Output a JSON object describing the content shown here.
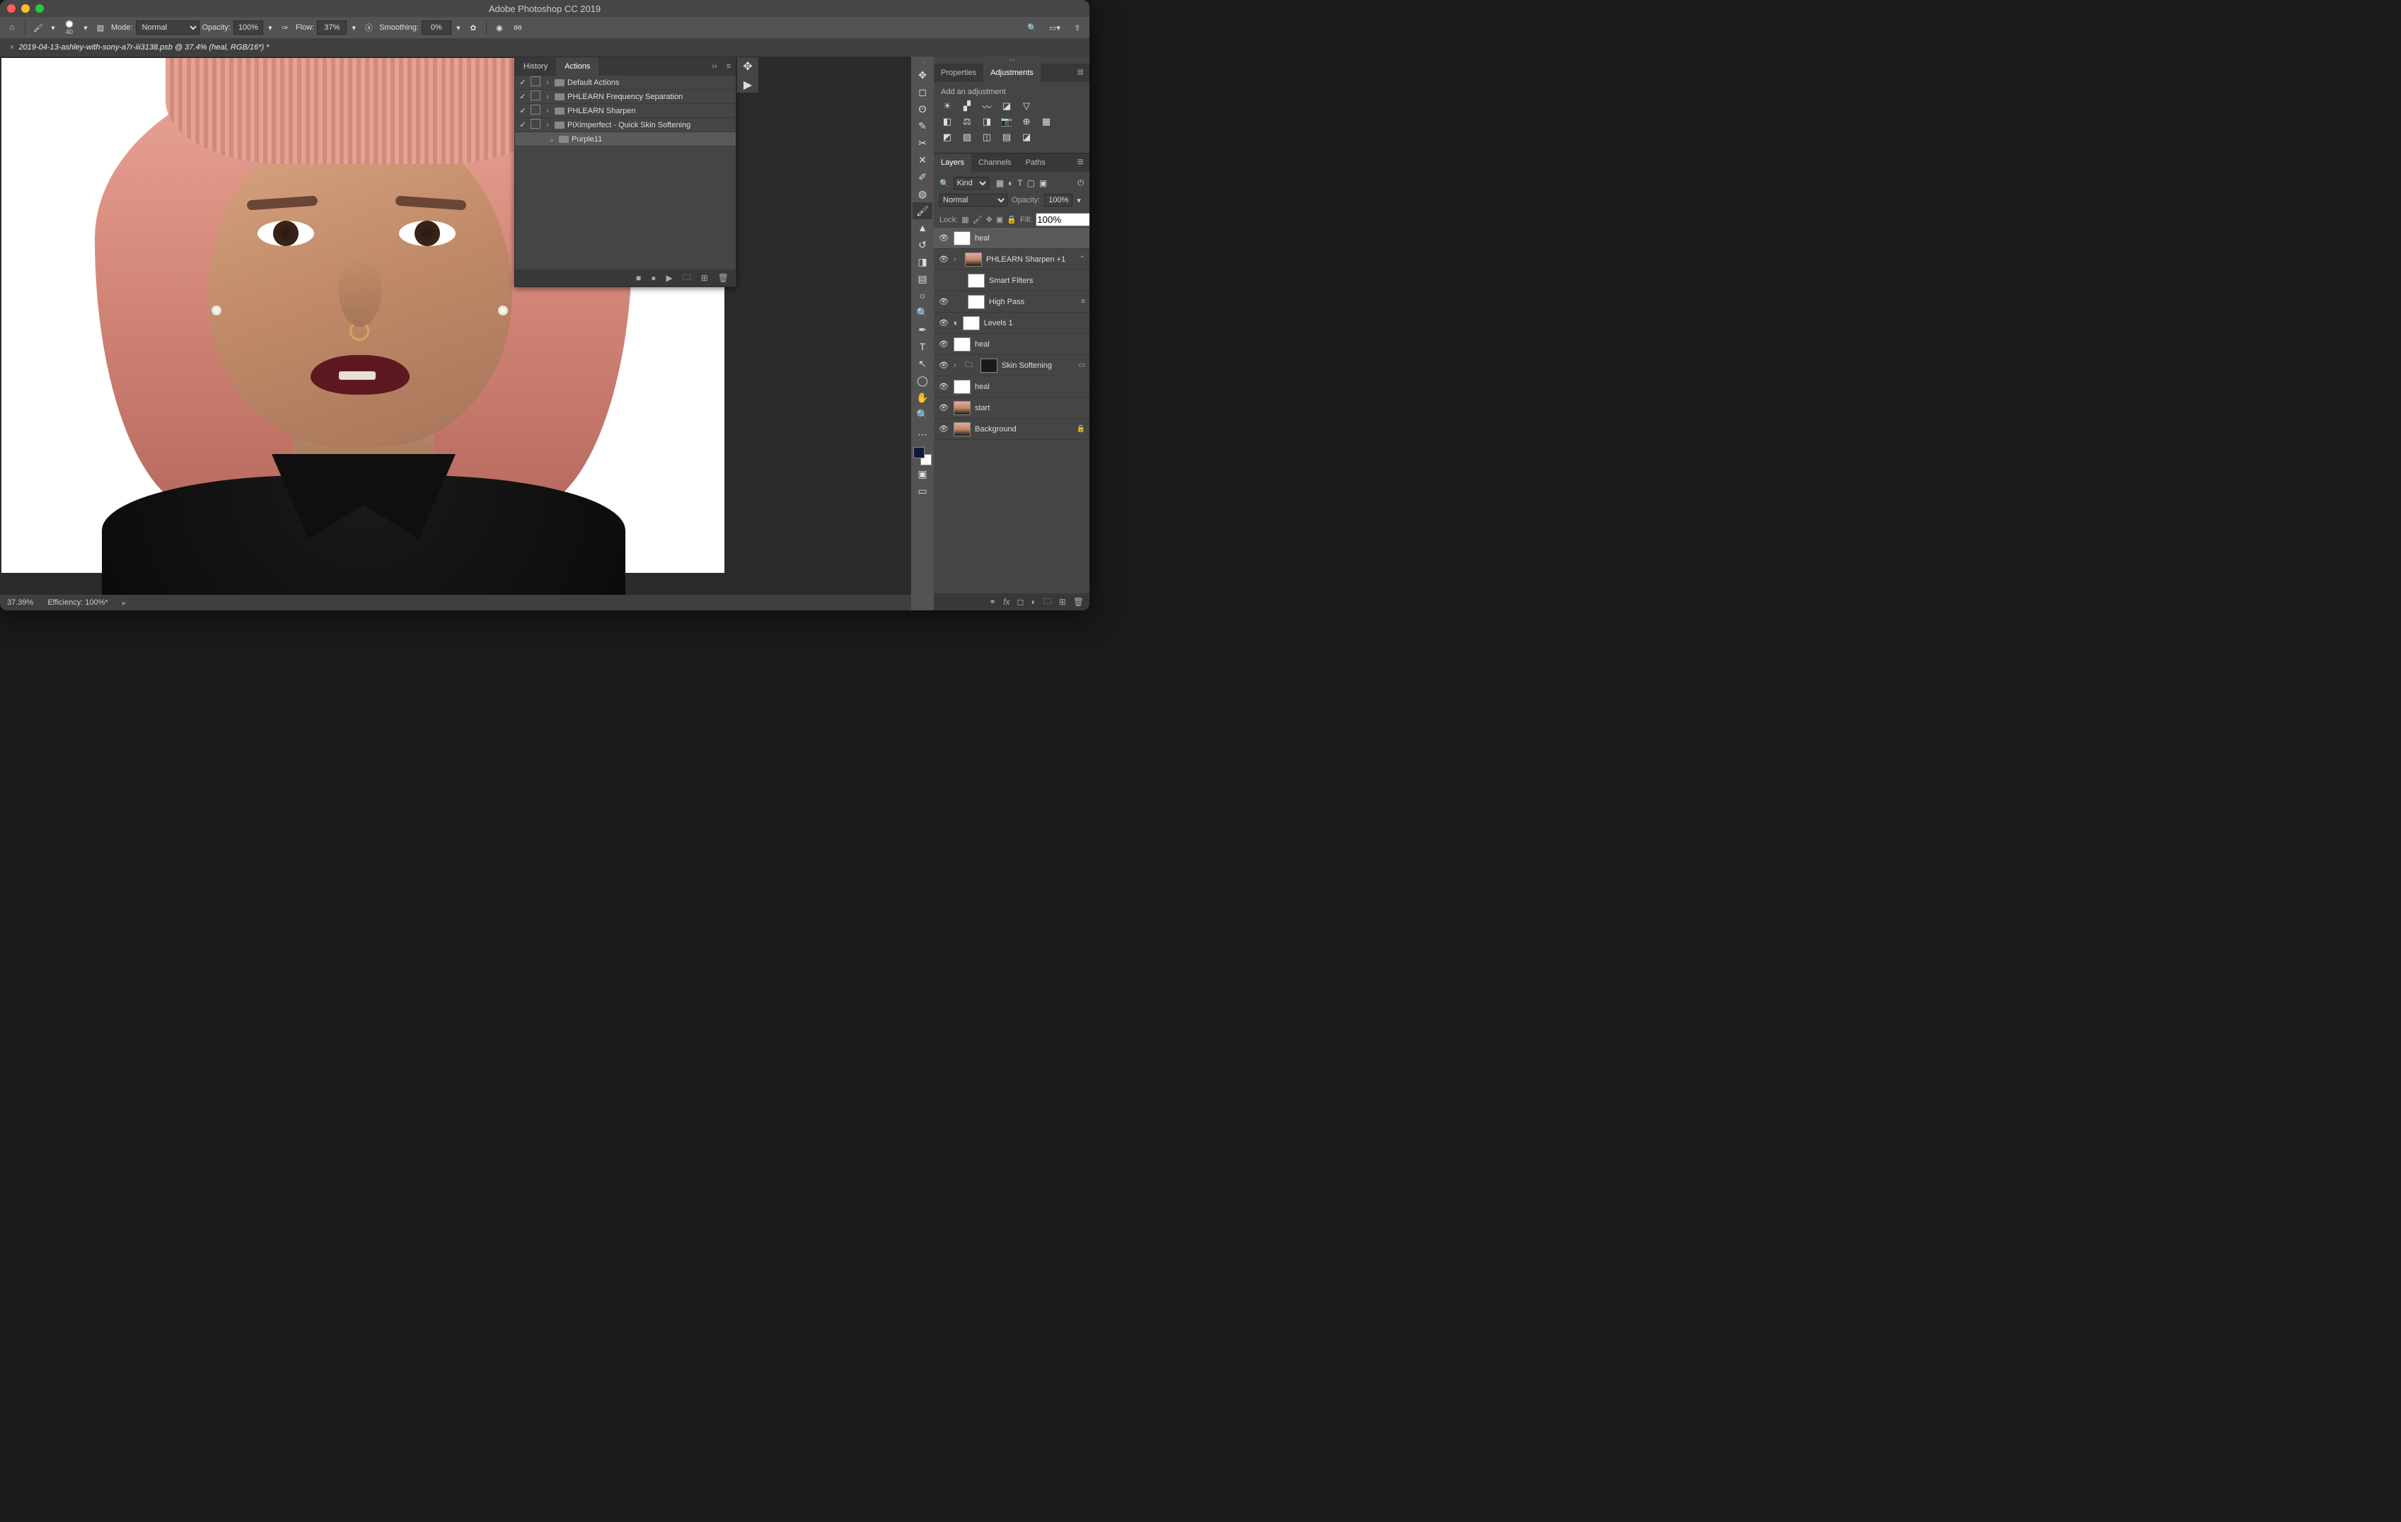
{
  "app_title": "Adobe Photoshop CC 2019",
  "document_tab": "2019-04-13-ashley-with-sony-a7r-iii3138.psb @ 37.4% (heal, RGB/16*) *",
  "options_bar": {
    "brush_size": "40",
    "mode_label": "Mode:",
    "mode_value": "Normal",
    "opacity_label": "Opacity:",
    "opacity_value": "100%",
    "flow_label": "Flow:",
    "flow_value": "37%",
    "smoothing_label": "Smoothing:",
    "smoothing_value": "0%"
  },
  "actions_panel": {
    "tab_history": "History",
    "tab_actions": "Actions",
    "items": [
      {
        "checked": true,
        "dialog": true,
        "label": "Default Actions"
      },
      {
        "checked": true,
        "dialog": true,
        "label": "PHLEARN Frequency Separation"
      },
      {
        "checked": true,
        "dialog": true,
        "label": "PHLEARN Sharpen"
      },
      {
        "checked": true,
        "dialog": true,
        "label": "PiXimperfect - Quick Skin Softening"
      },
      {
        "checked": false,
        "dialog": false,
        "label": "Purple11",
        "indent": true,
        "open": true,
        "selected": true
      }
    ]
  },
  "properties_panel": {
    "tab_properties": "Properties",
    "tab_adjustments": "Adjustments",
    "hint": "Add an adjustment"
  },
  "layers_panel": {
    "tab_layers": "Layers",
    "tab_channels": "Channels",
    "tab_paths": "Paths",
    "filter_kind": "Kind",
    "blend_mode": "Normal",
    "opacity_label": "Opacity:",
    "opacity_value": "100%",
    "lock_label": "Lock:",
    "fill_label": "Fill:",
    "fill_value": "100%",
    "layers": [
      {
        "name": "heal",
        "selected": true,
        "thumb": "white"
      },
      {
        "name": "PHLEARN Sharpen +1",
        "thumb": "portrait",
        "group_arrow": true,
        "badge": "⌃"
      },
      {
        "name": "Smart Filters",
        "indent": 1,
        "no_eye": true,
        "thumb": "white"
      },
      {
        "name": "High Pass",
        "indent": 1,
        "badge": "≡"
      },
      {
        "name": "Levels 1",
        "thumb": "white",
        "adj_icon": true
      },
      {
        "name": "heal",
        "thumb": "white"
      },
      {
        "name": "Skin Softening",
        "group": true,
        "thumb": "dark",
        "badge": "▭"
      },
      {
        "name": "heal",
        "thumb": "white"
      },
      {
        "name": "start",
        "thumb": "portrait"
      },
      {
        "name": "Background",
        "thumb": "portrait",
        "locked": true
      }
    ]
  },
  "status_bar": {
    "zoom": "37.39%",
    "efficiency": "Efficiency: 100%*"
  }
}
